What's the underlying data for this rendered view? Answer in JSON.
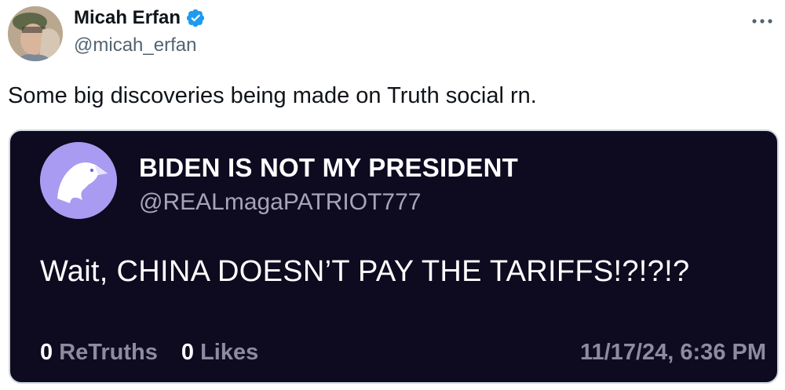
{
  "author": {
    "name": "Micah Erfan",
    "handle": "@micah_erfan"
  },
  "tweet": {
    "text": "Some big discoveries being made on Truth social rn."
  },
  "more_icon": "more-horizontal-icon",
  "embedded_post": {
    "name": "BIDEN IS NOT MY PRESIDENT",
    "handle": "@REALmagaPATRIOT777",
    "text": "Wait, CHINA DOESN’T PAY THE TARIFFS!?!?!?",
    "retruths_count": "0",
    "retruths_label": "ReTruths",
    "likes_count": "0",
    "likes_label": "Likes",
    "timestamp": "11/17/24, 6:36 PM"
  },
  "colors": {
    "verified_blue": "#1d9bf0",
    "card_background": "#0e0a1f",
    "truth_avatar": "#a99bf1"
  }
}
